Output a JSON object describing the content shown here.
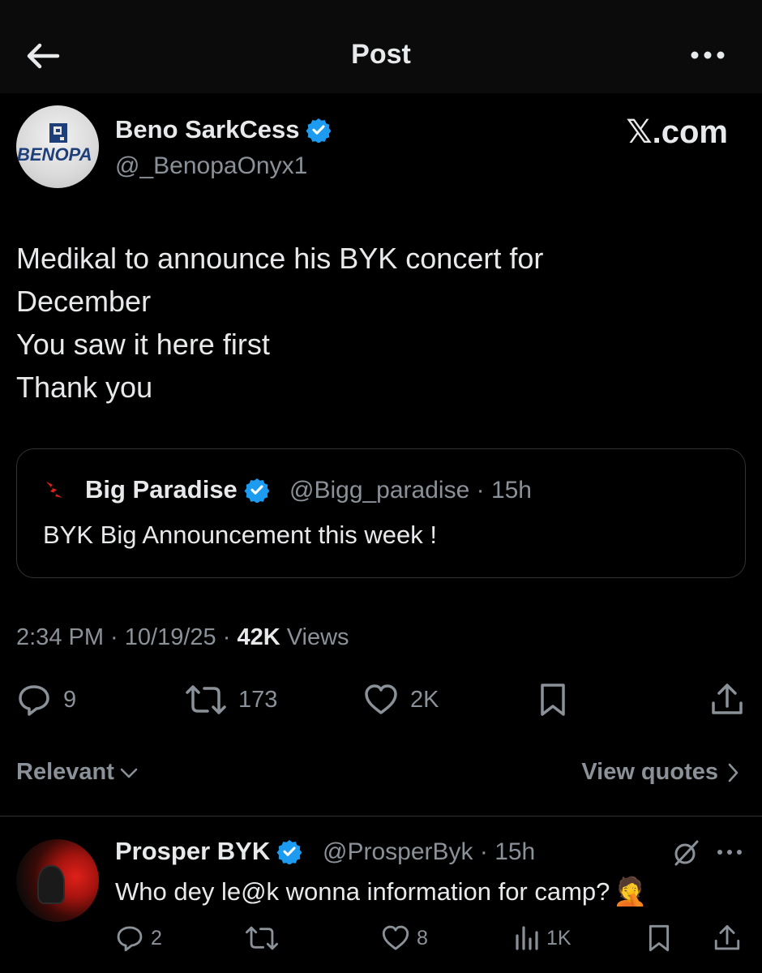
{
  "header": {
    "title": "Post",
    "back_icon": "arrow-left-icon",
    "more_icon": "more-horizontal-icon"
  },
  "post": {
    "author_name": "Beno SarkCess",
    "author_handle": "@_BenopaOnyx1",
    "avatar_logo_text": "BENOPA",
    "brand": "𝕏.com",
    "lines": [
      "Medikal to announce his BYK concert for",
      "December",
      "You saw it here first",
      "Thank you"
    ],
    "quote": {
      "name": "Big Paradise",
      "handle": "@Bigg_paradise",
      "time": "15h",
      "text": "BYK Big Announcement this week !"
    },
    "time": "2:34 PM",
    "date": "10/19/25",
    "views_count": "42K",
    "views_label": "Views",
    "stats": {
      "replies": "9",
      "reposts": "173",
      "likes": "2K"
    }
  },
  "filters": {
    "sort_label": "Relevant",
    "quotes_label": "View quotes"
  },
  "reply": {
    "author_name": "Prosper BYK",
    "handle": "@ProsperByk",
    "time": "15h",
    "text": "Who dey le@k wonna information for camp?",
    "emoji": "🤦",
    "stats": {
      "replies": "2",
      "likes": "8",
      "views": "1K"
    }
  },
  "colors": {
    "background": "#000000",
    "text": "#e7e9ea",
    "muted": "#8b9198",
    "verified": "#1d9bf0",
    "border": "#2f3336"
  }
}
